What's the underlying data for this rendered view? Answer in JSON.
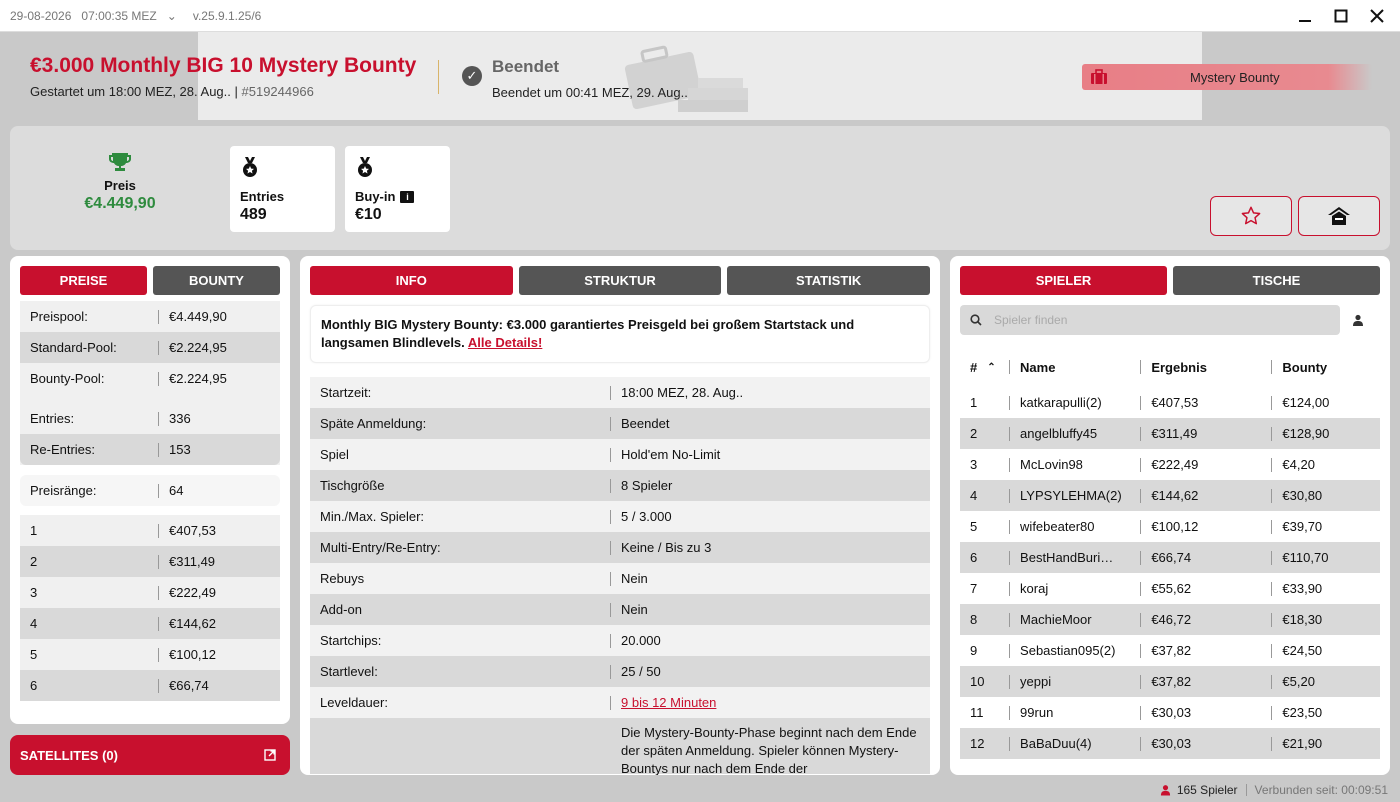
{
  "titlebar": {
    "date": "29-08-2026",
    "time": "07:00:35 MEZ",
    "version": "v.25.9.1.25/6"
  },
  "header": {
    "title": "€3.000 Monthly BIG 10 Mystery Bounty",
    "started": "Gestartet um 18:00 MEZ, 28. Aug.. |",
    "id": "#519244966",
    "status_title": "Beendet",
    "status_sub": "Beendet um 00:41 MEZ, 29. Aug..",
    "badge": "Mystery Bounty"
  },
  "stats": {
    "prize_label": "Preis",
    "prize_value": "€4.449,90",
    "entries_label": "Entries",
    "entries_value": "489",
    "buyin_label": "Buy-in",
    "buyin_value": "€10"
  },
  "left": {
    "tabs": [
      "PREISE",
      "BOUNTY"
    ],
    "pool_rows": [
      {
        "k": "Preispool:",
        "v": "€4.449,90"
      },
      {
        "k": "Standard-Pool:",
        "v": "€2.224,95"
      },
      {
        "k": "Bounty-Pool:",
        "v": "€2.224,95"
      }
    ],
    "entry_rows": [
      {
        "k": "Entries:",
        "v": "336"
      },
      {
        "k": "Re-Entries:",
        "v": "153"
      }
    ],
    "ranks": {
      "k": "Preisränge:",
      "v": "64"
    },
    "payouts": [
      {
        "k": "1",
        "v": "€407,53"
      },
      {
        "k": "2",
        "v": "€311,49"
      },
      {
        "k": "3",
        "v": "€222,49"
      },
      {
        "k": "4",
        "v": "€144,62"
      },
      {
        "k": "5",
        "v": "€100,12"
      },
      {
        "k": "6",
        "v": "€66,74"
      }
    ],
    "satellites": "SATELLITES (0)"
  },
  "middle": {
    "tabs": [
      "INFO",
      "STRUKTUR",
      "STATISTIK"
    ],
    "desc": "Monthly BIG Mystery Bounty: €3.000 garantiertes Preisgeld bei großem Startstack und langsamen Blindlevels.",
    "desc_link": "Alle Details!",
    "rows": [
      {
        "k": "Startzeit:",
        "v": "18:00 MEZ, 28. Aug.."
      },
      {
        "k": "Späte Anmeldung:",
        "v": "Beendet"
      },
      {
        "k": "Spiel",
        "v": "Hold'em No-Limit"
      },
      {
        "k": "Tischgröße",
        "v": "8 Spieler"
      },
      {
        "k": "Min./Max. Spieler:",
        "v": "5 / 3.000"
      },
      {
        "k": "Multi-Entry/Re-Entry:",
        "v": "Keine / Bis zu 3"
      },
      {
        "k": "Rebuys",
        "v": "Nein"
      },
      {
        "k": "Add-on",
        "v": "Nein"
      },
      {
        "k": "Startchips:",
        "v": "20.000"
      },
      {
        "k": "Startlevel:",
        "v": "25 / 50"
      }
    ],
    "level_label": "Leveldauer:",
    "level_value": "9 bis 12 Minuten",
    "bounty_text": "Die Mystery-Bounty-Phase beginnt nach dem Ende der späten Anmeldung. Spieler können Mystery-Bountys nur nach dem Ende der"
  },
  "right": {
    "tabs": [
      "SPIELER",
      "TISCHE"
    ],
    "search_placeholder": "Spieler finden",
    "headers": [
      "#",
      "Name",
      "Ergebnis",
      "Bounty"
    ],
    "players": [
      {
        "n": "1",
        "name": "katkarapulli(2)",
        "res": "€407,53",
        "bounty": "€124,00"
      },
      {
        "n": "2",
        "name": "angelbluffy45",
        "res": "€311,49",
        "bounty": "€128,90"
      },
      {
        "n": "3",
        "name": "McLovin98",
        "res": "€222,49",
        "bounty": "€4,20"
      },
      {
        "n": "4",
        "name": "LYPSYLEHMA(2)",
        "res": "€144,62",
        "bounty": "€30,80"
      },
      {
        "n": "5",
        "name": "wifebeater80",
        "res": "€100,12",
        "bounty": "€39,70"
      },
      {
        "n": "6",
        "name": "BestHandBuri…",
        "res": "€66,74",
        "bounty": "€110,70"
      },
      {
        "n": "7",
        "name": "koraj",
        "res": "€55,62",
        "bounty": "€33,90"
      },
      {
        "n": "8",
        "name": "MachieMoor",
        "res": "€46,72",
        "bounty": "€18,30"
      },
      {
        "n": "9",
        "name": "Sebastian095(2)",
        "res": "€37,82",
        "bounty": "€24,50"
      },
      {
        "n": "10",
        "name": "yeppi",
        "res": "€37,82",
        "bounty": "€5,20"
      },
      {
        "n": "11",
        "name": "99run",
        "res": "€30,03",
        "bounty": "€23,50"
      },
      {
        "n": "12",
        "name": "BaBaDuu(4)",
        "res": "€30,03",
        "bounty": "€21,90"
      }
    ]
  },
  "statusbar": {
    "players": "165 Spieler",
    "connected": "Verbunden seit: 00:09:51"
  },
  "colors": {
    "accent": "#c8102e",
    "prize_green": "#2e8b3e",
    "tab_inactive": "#555555"
  }
}
